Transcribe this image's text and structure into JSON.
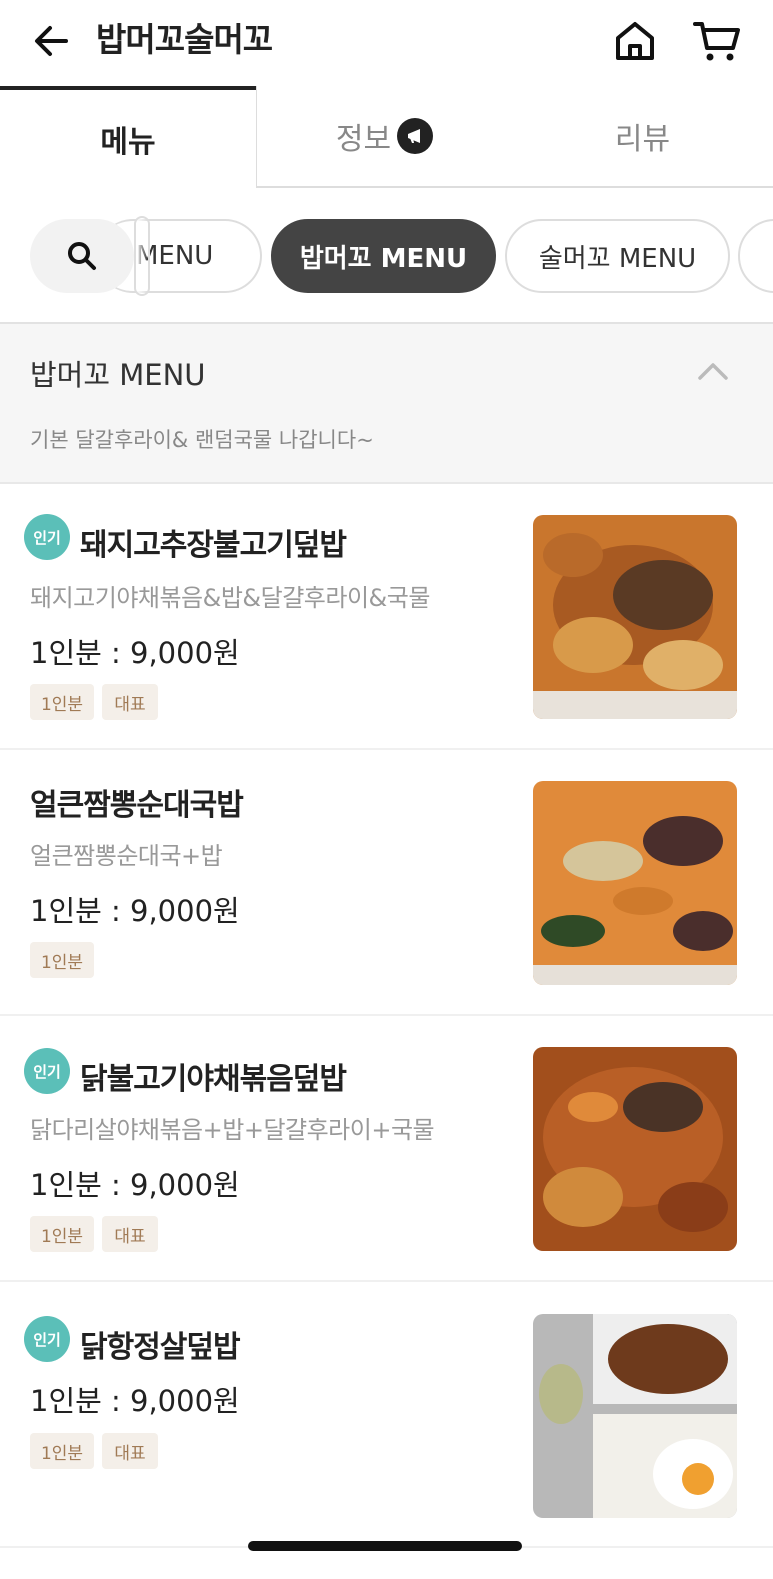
{
  "header": {
    "store_name": "밥머꼬술머꼬"
  },
  "tabs": [
    {
      "label": "메뉴",
      "active": true
    },
    {
      "label": "정보",
      "active": false
    },
    {
      "label": "리뷰",
      "active": false
    }
  ],
  "categories": {
    "partial_label": "MENU",
    "selected_label": "밥머꼬 MENU",
    "next_label": "술머꼬 MENU"
  },
  "section": {
    "title": "밥머꼬 MENU",
    "description": "기본 달갈후라이& 랜덤국물 나갑니다~"
  },
  "items": [
    {
      "badge": "인기",
      "name": "돼지고추장불고기덮밥",
      "description": "돼지고기야채볶음&밥&달걀후라이&국물",
      "price": "1인분 : 9,000원",
      "tags": [
        "1인분",
        "대표"
      ]
    },
    {
      "badge": "",
      "name": "얼큰짬뽕순대국밥",
      "description": "얼큰짬뽕순대국+밥",
      "price": "1인분 : 9,000원",
      "tags": [
        "1인분"
      ]
    },
    {
      "badge": "인기",
      "name": "닭불고기야채볶음덮밥",
      "description": "닭다리살야채볶음+밥+달걀후라이+국물",
      "price": "1인분 : 9,000원",
      "tags": [
        "1인분",
        "대표"
      ]
    },
    {
      "badge": "인기",
      "name": "닭항정살덮밥",
      "description": "",
      "price": "1인분 : 9,000원",
      "tags": [
        "1인분",
        "대표"
      ]
    }
  ],
  "colors": {
    "popular_badge": "#5bbfb8",
    "selected_chip": "#444444",
    "tag_bg": "#f4efe9",
    "tag_text": "#a07a55"
  },
  "icons": {
    "back": "arrow-left-icon",
    "home": "home-icon",
    "cart": "cart-icon",
    "search": "search-icon",
    "info_badge": "megaphone-icon",
    "collapse": "chevron-up-icon"
  }
}
